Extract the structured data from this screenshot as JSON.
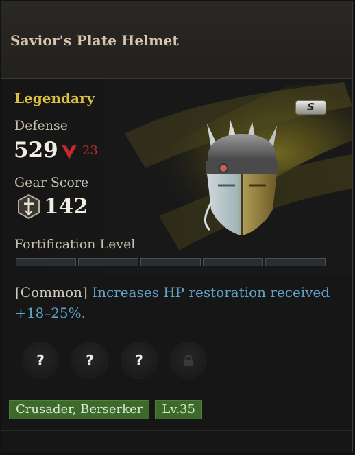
{
  "item": {
    "name": "Savior's Plate Helmet",
    "grade": "Legendary",
    "tier_badge": "S"
  },
  "stats": {
    "defense_label": "Defense",
    "defense_value": "529",
    "defense_diff": "23",
    "gear_score_label": "Gear Score",
    "gear_score_value": "142"
  },
  "fortification": {
    "label": "Fortification Level",
    "segments": 5,
    "filled": 0
  },
  "effect": {
    "tag": "[Common]",
    "text": "Increases HP restoration received +18–25%."
  },
  "sockets": [
    {
      "state": "unknown",
      "symbol": "?"
    },
    {
      "state": "unknown",
      "symbol": "?"
    },
    {
      "state": "unknown",
      "symbol": "?"
    },
    {
      "state": "locked",
      "symbol": "lock-icon"
    }
  ],
  "tags": {
    "classes": "Crusader, Berserker",
    "level": "Lv.35"
  },
  "colors": {
    "grade": "#d7bf41",
    "effect_text": "#5fa2c6",
    "stat_decrease": "#c32a2a",
    "tag_bg": "#3d6a2c"
  }
}
